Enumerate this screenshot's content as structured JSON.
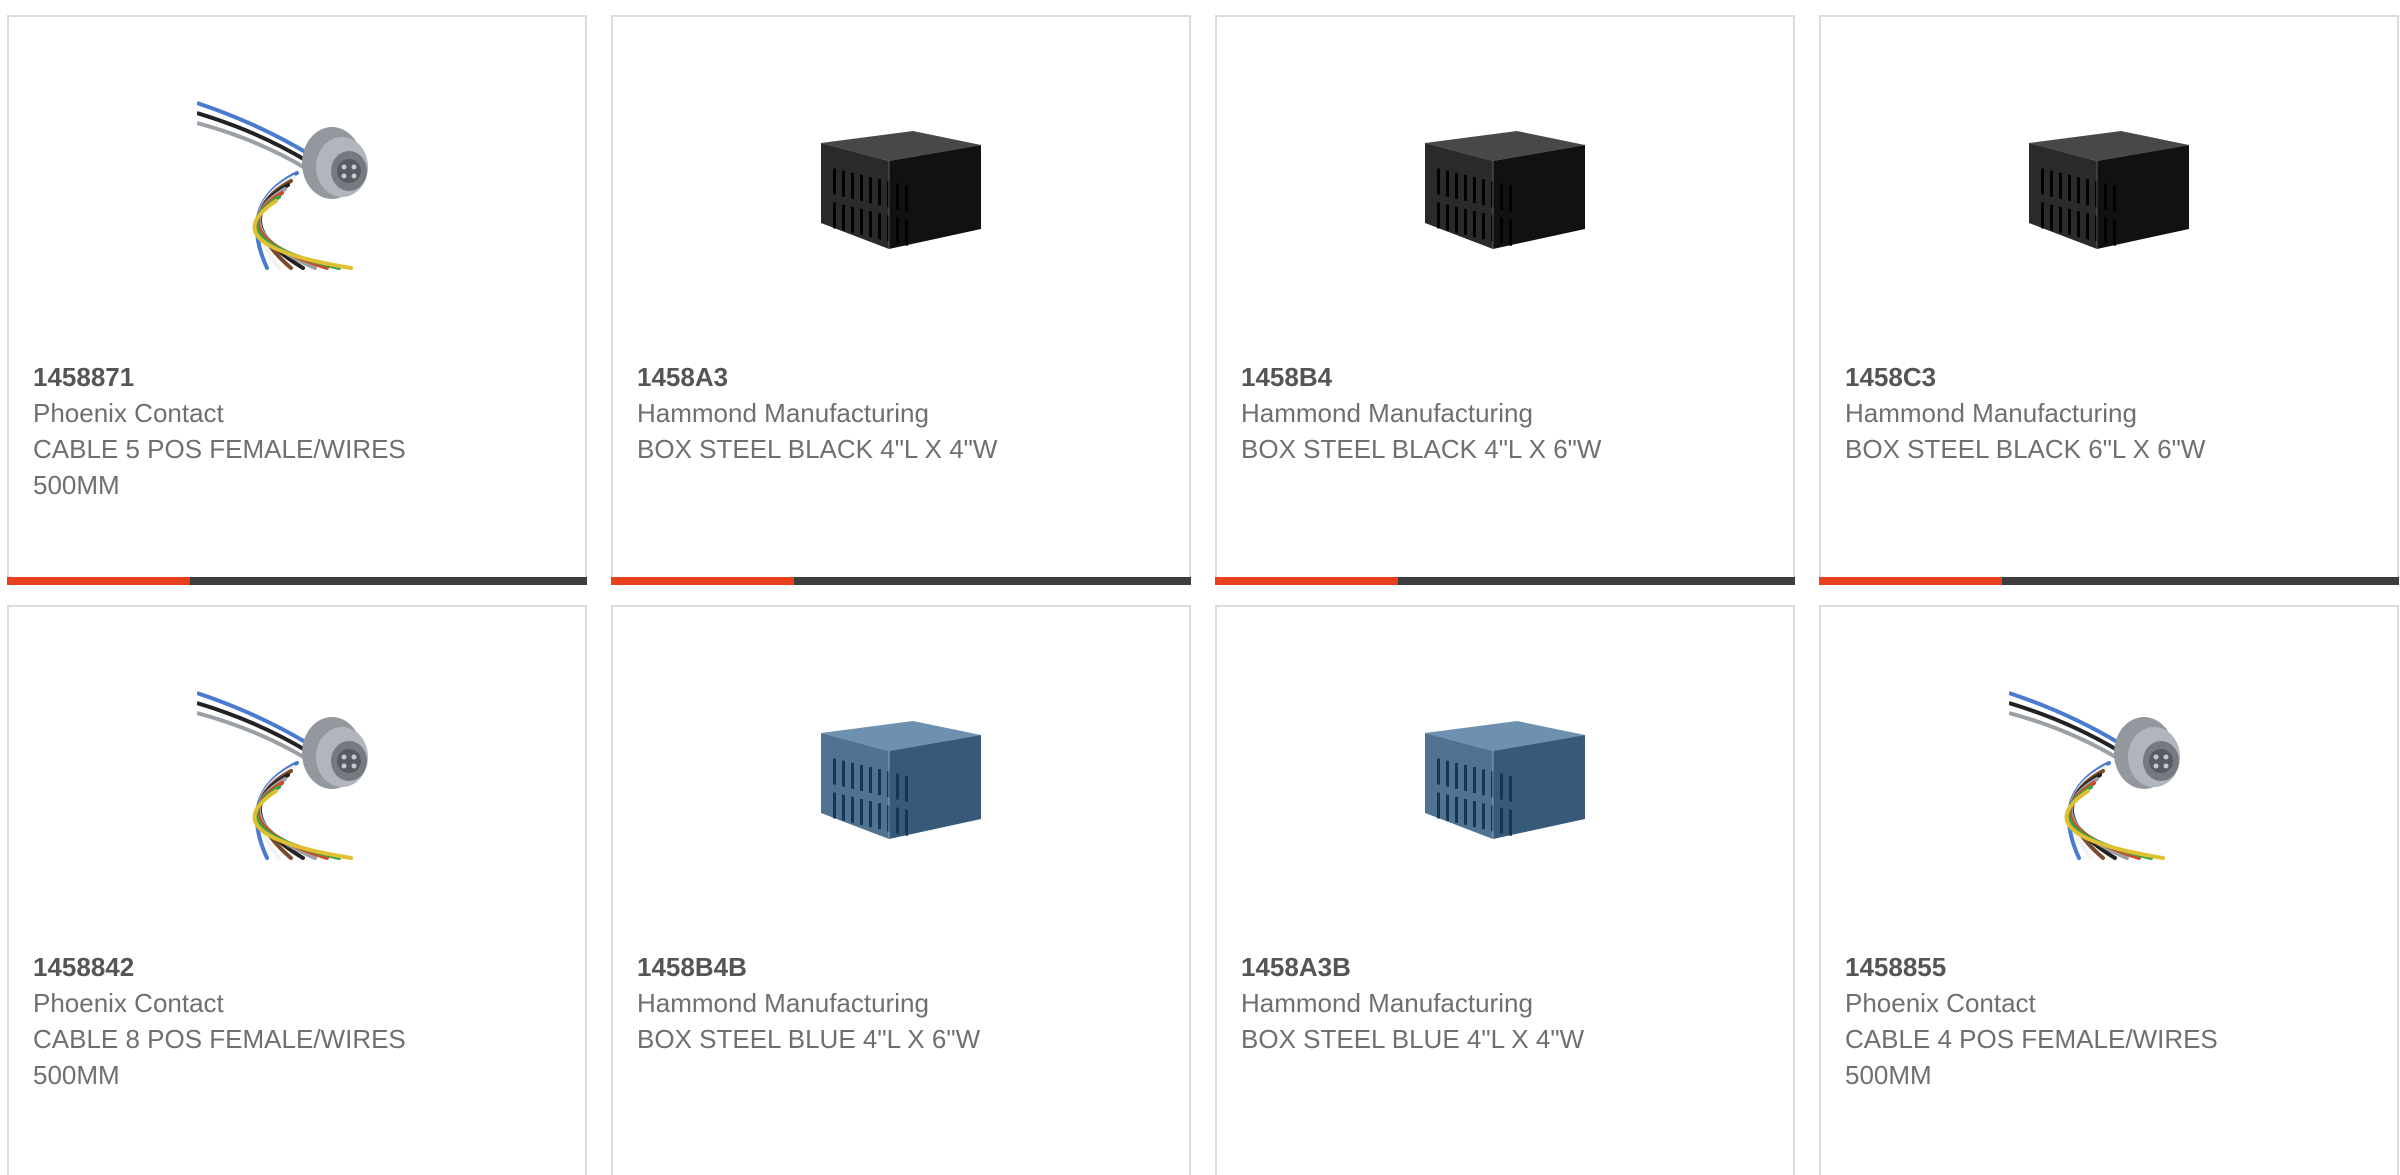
{
  "products": [
    {
      "part_number": "1458871",
      "manufacturer": "Phoenix Contact",
      "description": "CABLE 5 POS FEMALE/WIRES 500MM",
      "image": "cable-connector-icon",
      "image_color": "#b0b6bb"
    },
    {
      "part_number": "1458A3",
      "manufacturer": "Hammond Manufacturing",
      "description": "BOX STEEL BLACK 4\"L X 4\"W",
      "image": "steel-box-icon",
      "image_color": "#2a2a2a"
    },
    {
      "part_number": "1458B4",
      "manufacturer": "Hammond Manufacturing",
      "description": "BOX STEEL BLACK 4\"L X 6\"W",
      "image": "steel-box-icon",
      "image_color": "#2a2a2a"
    },
    {
      "part_number": "1458C3",
      "manufacturer": "Hammond Manufacturing",
      "description": "BOX STEEL BLACK 6\"L X 6\"W",
      "image": "steel-box-icon",
      "image_color": "#2a2a2a"
    },
    {
      "part_number": "1458842",
      "manufacturer": "Phoenix Contact",
      "description": "CABLE 8 POS FEMALE/WIRES 500MM",
      "image": "cable-connector-icon",
      "image_color": "#b0b6bb"
    },
    {
      "part_number": "1458B4B",
      "manufacturer": "Hammond Manufacturing",
      "description": "BOX STEEL BLUE 4\"L X 6\"W",
      "image": "steel-box-icon",
      "image_color": "#4f7391"
    },
    {
      "part_number": "1458A3B",
      "manufacturer": "Hammond Manufacturing",
      "description": "BOX STEEL BLUE 4\"L X 4\"W",
      "image": "steel-box-icon",
      "image_color": "#4f7391"
    },
    {
      "part_number": "1458855",
      "manufacturer": "Phoenix Contact",
      "description": "CABLE 4 POS FEMALE/WIRES 500MM",
      "image": "cable-connector-icon",
      "image_color": "#b0b6bb"
    }
  ],
  "colors": {
    "accent": "#e8401d",
    "bar": "#3d3d3d",
    "border": "#dcdcdc",
    "part_number": "#555555",
    "text": "#6f6f6f"
  }
}
